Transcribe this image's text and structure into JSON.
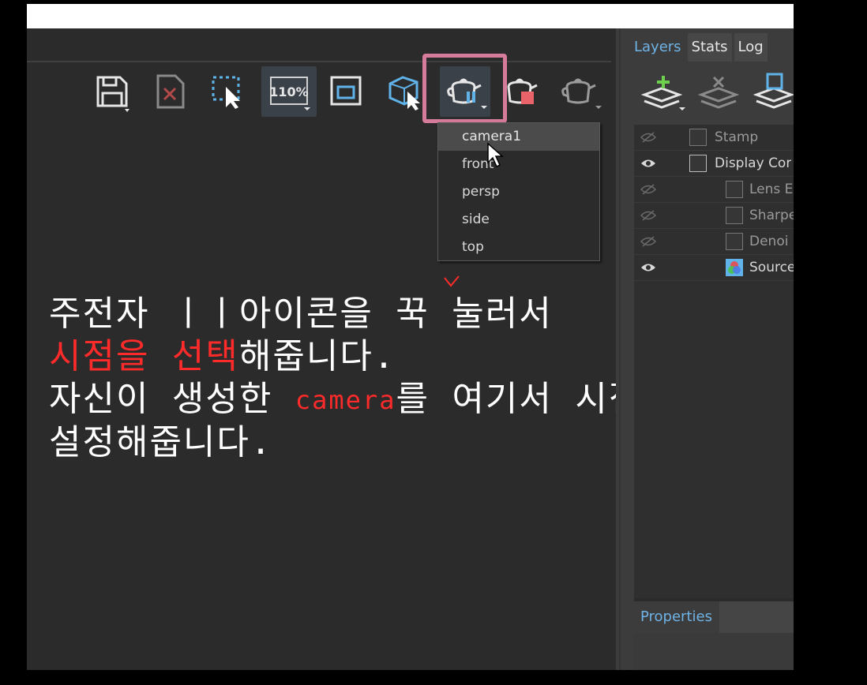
{
  "toolbar": {
    "zoom_label": "110%"
  },
  "camera_menu": {
    "items": [
      "camera1",
      "front",
      "persp",
      "side",
      "top"
    ],
    "hovered": "camera1"
  },
  "instruction": {
    "line1": "주전자 ㅣㅣ아이콘을 꾹 눌러서",
    "line2_red": "시점을 선택",
    "line2_rest": "해줍니다.",
    "line3_a": "자신이 생성한 ",
    "line3_red": "camera",
    "line3_b": "를 여기서 시점으로",
    "line4": "설정해줍니다."
  },
  "panel": {
    "tabs": [
      "Layers",
      "Stats",
      "Log"
    ],
    "active_tab": "Layers",
    "layers": [
      {
        "name": "Stamp",
        "visible": false
      },
      {
        "name": "Display Cor",
        "visible": true
      },
      {
        "name": "Lens E",
        "visible": false
      },
      {
        "name": "Sharpe",
        "visible": false
      },
      {
        "name": "Denoi",
        "visible": false
      },
      {
        "name": "Source",
        "visible": true
      }
    ],
    "properties_tab": "Properties"
  },
  "colors": {
    "highlight_border": "#d67b9c",
    "accent_blue": "#6fb3e6",
    "annotation_red": "#ff2b2b"
  }
}
